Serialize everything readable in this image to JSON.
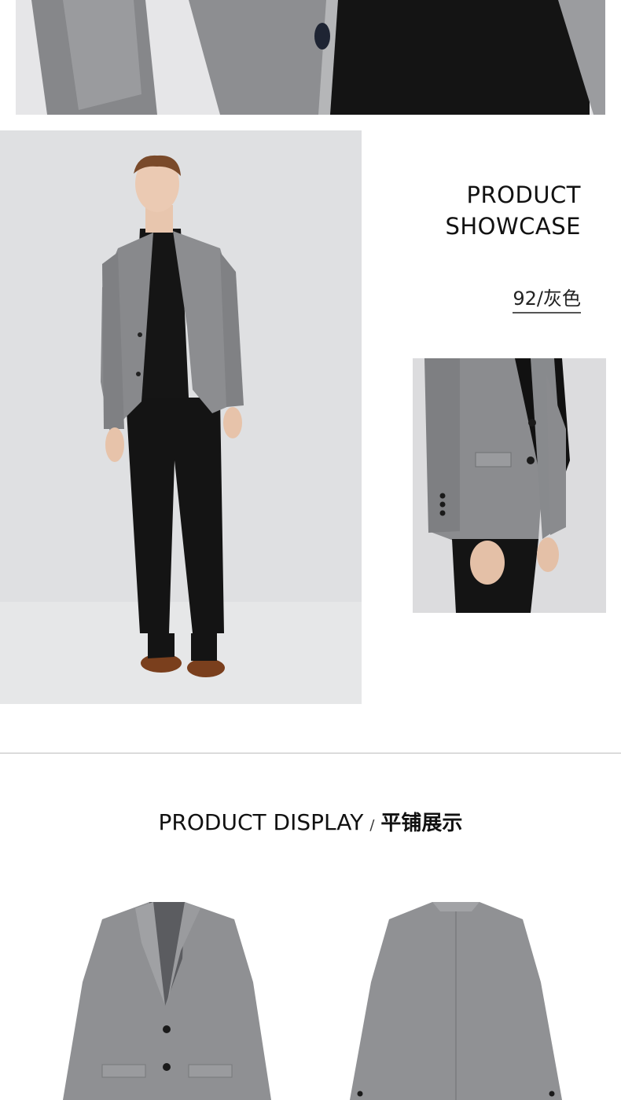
{
  "showcase": {
    "title_line1": "PRODUCT",
    "title_line2": "SHOWCASE",
    "color_tag": "92/灰色"
  },
  "display": {
    "title_en": "PRODUCT DISPLAY",
    "separator": "/",
    "title_cn": "平铺展示"
  },
  "colors": {
    "background": "#ffffff",
    "jacket_gray": "#8c8d90",
    "photo_backdrop": "#e0e1e3",
    "divider": "#bdbdbd"
  }
}
